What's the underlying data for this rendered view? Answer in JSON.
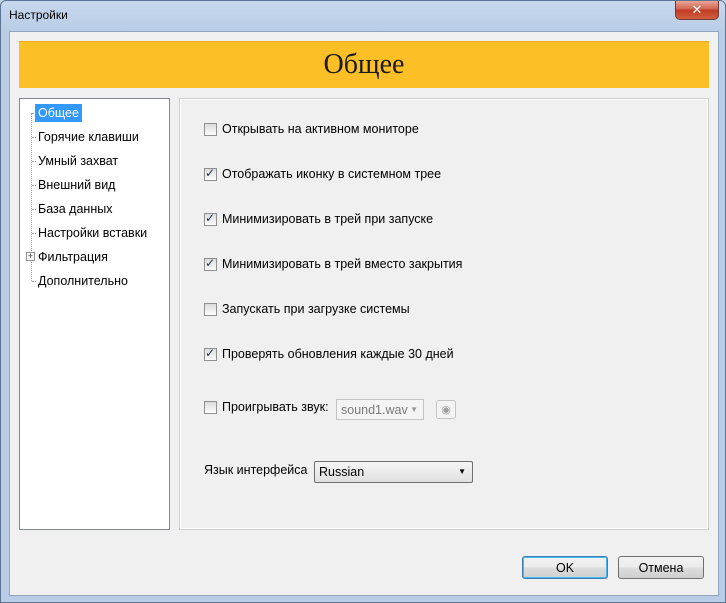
{
  "window": {
    "title": "Настройки",
    "close_glyph": "✕"
  },
  "banner": {
    "title": "Общее",
    "color": "#fcbf26"
  },
  "tree": {
    "items": [
      {
        "label": "Общее",
        "selected": true
      },
      {
        "label": "Горячие клавиши"
      },
      {
        "label": "Умный захват"
      },
      {
        "label": "Внешний вид"
      },
      {
        "label": "База данных"
      },
      {
        "label": "Настройки вставки"
      },
      {
        "label": "Фильтрация",
        "expandable": true
      },
      {
        "label": "Дополнительно"
      }
    ],
    "expander_glyph": "+"
  },
  "options": [
    {
      "label": "Открывать на активном мониторе",
      "checked": false
    },
    {
      "label": "Отображать иконку в системном трее",
      "checked": true
    },
    {
      "label": "Минимизировать в трей при запуске",
      "checked": true
    },
    {
      "label": "Минимизировать в трей вместо закрытия",
      "checked": true
    },
    {
      "label": "Запускать при загрузке системы",
      "checked": false
    },
    {
      "label": "Проверять обновления каждые 30 дней",
      "checked": true
    }
  ],
  "sound": {
    "label": "Проигрывать звук:",
    "checked": false,
    "file": "sound1.wav",
    "play_glyph": "◉"
  },
  "language": {
    "label": "Язык интерфейса",
    "value": "Russian"
  },
  "buttons": {
    "ok": "OK",
    "cancel": "Отмена"
  },
  "glyphs": {
    "dropdown": "▼"
  }
}
